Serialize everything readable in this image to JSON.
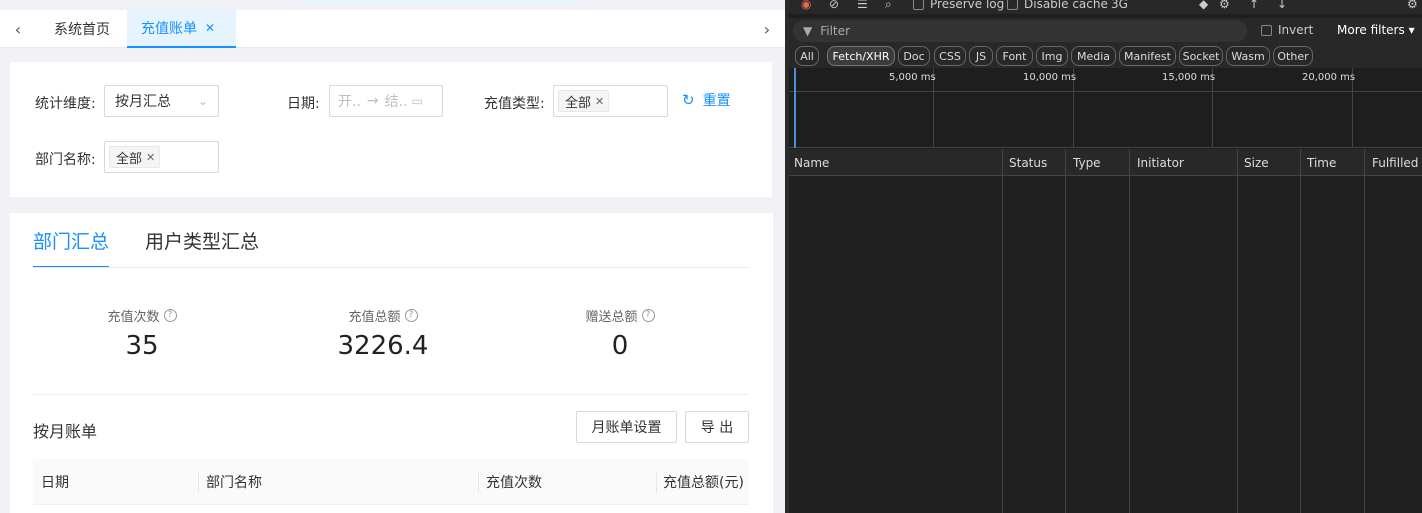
{
  "tabs": {
    "home": "系统首页",
    "active": "充值账单"
  },
  "filters": {
    "dimension_label": "统计维度:",
    "dimension_value": "按月汇总",
    "date_label": "日期:",
    "date_start_ph": "开..",
    "date_arrow": "→",
    "date_end_ph": "结..",
    "type_label": "充值类型:",
    "type_tag": "全部",
    "dept_label": "部门名称:",
    "dept_tag": "全部",
    "reset": "重置"
  },
  "main": {
    "tab_dept": "部门汇总",
    "tab_user": "用户类型汇总",
    "stats": [
      {
        "label": "充值次数",
        "value": "35"
      },
      {
        "label": "充值总额",
        "value": "3226.4"
      },
      {
        "label": "赠送总额",
        "value": "0"
      }
    ],
    "monthly_title": "按月账单",
    "btn_settings": "月账单设置",
    "btn_export": "导 出",
    "table_headers": [
      "日期",
      "部门名称",
      "充值次数",
      "充值总额(元)"
    ]
  },
  "devtools": {
    "preserve_log": "Preserve log",
    "disable_cache": "Disable cache",
    "throttle": "3G",
    "filter_placeholder": "Filter",
    "invert": "Invert",
    "more_filters": "More filters",
    "pills": [
      "All",
      "Fetch/XHR",
      "Doc",
      "CSS",
      "JS",
      "Font",
      "Img",
      "Media",
      "Manifest",
      "Socket",
      "Wasm",
      "Other"
    ],
    "selected_pill": "Fetch/XHR",
    "ticks": [
      "5,000 ms",
      "10,000 ms",
      "15,000 ms",
      "20,000 ms"
    ],
    "columns": [
      "Name",
      "Status",
      "Type",
      "Initiator",
      "Size",
      "Time",
      "Fulfilled by"
    ]
  }
}
